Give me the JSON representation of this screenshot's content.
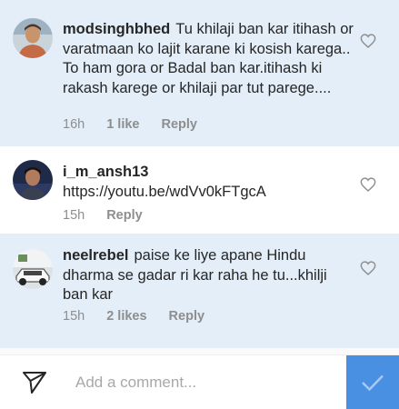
{
  "comments": [
    {
      "username": "modsinghbhed",
      "text": "Tu khilaji ban kar itihash or varatmaan ko lajit karane ki kosish karega.. To ham gora or Badal ban kar.itihash ki rakash karege or khilaji par tut parege....",
      "time": "16h",
      "likes": "1 like",
      "reply": "Reply",
      "avatar_icon": "profile-photo",
      "like_icon": "heart-outline-icon"
    },
    {
      "username": "i_m_ansh13",
      "text": "https://youtu.be/wdVv0kFTgcA",
      "time": "15h",
      "likes": "",
      "reply": "Reply",
      "avatar_icon": "profile-photo",
      "like_icon": "heart-outline-icon"
    },
    {
      "username": "neelrebel",
      "text": "paise ke liye apane Hindu dharma se gadar ri kar raha he tu...khilji ban kar",
      "time": "15h",
      "likes": "2 likes",
      "reply": "Reply",
      "avatar_icon": "profile-photo",
      "like_icon": "heart-outline-icon"
    }
  ],
  "composer": {
    "placeholder": "Add a comment...",
    "send_icon": "paper-plane-icon",
    "post_icon": "checkmark-icon"
  },
  "colors": {
    "highlight": "#e3eef9",
    "accent": "#4a90e2",
    "muted": "#8e8e8e"
  }
}
